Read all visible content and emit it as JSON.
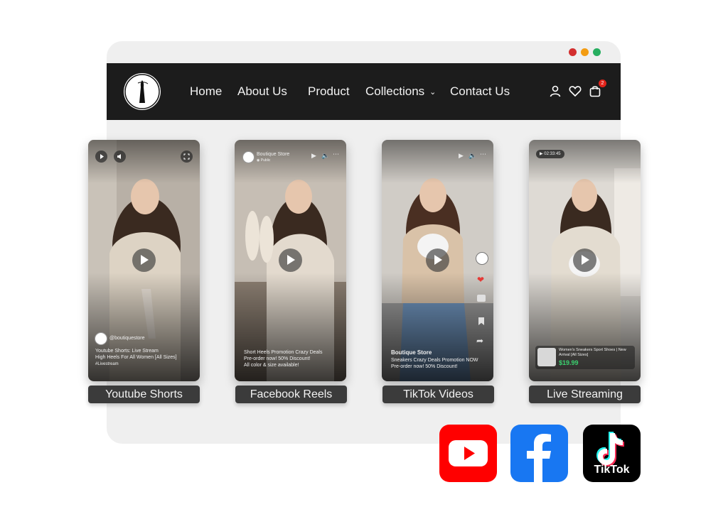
{
  "colors": {
    "navbar": "#1c1c1c",
    "browser": "#efefef",
    "label_bg": "#3b3b3b",
    "youtube": "#ff0000",
    "facebook": "#1877f2",
    "tiktok": "#000000",
    "dot_red": "#d32f2f",
    "dot_orange": "#f39c12",
    "dot_green": "#27ae60",
    "badge": "#e2231a",
    "price": "#3bd16f"
  },
  "nav": {
    "items": [
      "Home",
      "About Us",
      "Product",
      "Collections",
      "Contact Us"
    ],
    "cart_count": "2"
  },
  "cards": [
    {
      "label": "Youtube Shorts",
      "account": "@boutiquestore",
      "lines": [
        "Youtube Shorts: Live Stream",
        "High Heels For All Women [All Sizes]",
        "#Livestream"
      ]
    },
    {
      "label": "Facebook Reels",
      "page_name": "Boutique Store",
      "privacy": "Public",
      "lines": [
        "Short Heels Promotion Crazy Deals",
        "Pre-order now! 50% Discount!",
        "All color & size available!"
      ]
    },
    {
      "label": "TikTok Videos",
      "title": "Boutique Store",
      "lines": [
        "Sneakers Crazy Deals Promotion NOW",
        "Pre-order now! 50% Discount!"
      ]
    },
    {
      "label": "Live Streaming",
      "timer": "02:33:45",
      "product_title": "Women's Sneakers Sport Shoes | New Arrival [All Sizes]",
      "price": "$19.99"
    }
  ],
  "social": {
    "tiktok_text": "TikTok"
  }
}
